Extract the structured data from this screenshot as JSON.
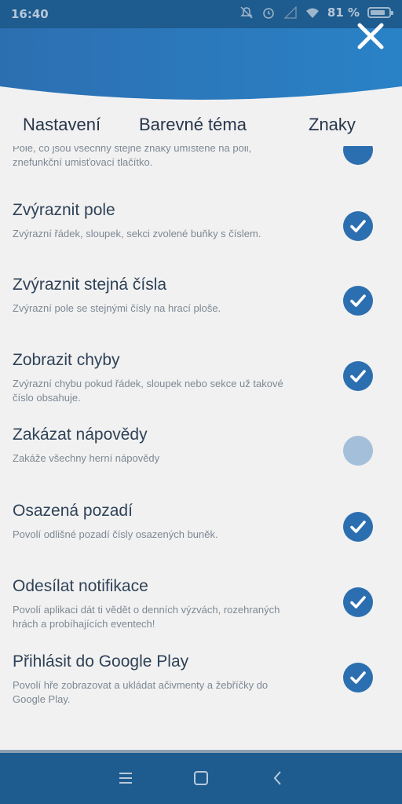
{
  "status": {
    "time": "16:40",
    "battery": "81 %",
    "battery_level": 0.81,
    "icons": [
      "mute-icon",
      "alarm-icon",
      "signal-icon",
      "wifi-icon",
      "battery-icon"
    ]
  },
  "header": {
    "close_icon": "close-icon"
  },
  "tabs": [
    "Nastavení",
    "Barevné téma",
    "Znaky"
  ],
  "partial_item": {
    "desc": "Pole, co jsou všechny stejné znaky umístěné na poli, znefunkční umisťovací tlačítko."
  },
  "items": [
    {
      "title": "Zvýraznit pole",
      "desc": "Zvýrazní řádek, sloupek, sekci zvolené buňky s číslem.",
      "checked": true
    },
    {
      "title": "Zvýraznit stejná čísla",
      "desc": "Zvýrazní pole se stejnými čísly na hrací ploše.",
      "checked": true
    },
    {
      "title": "Zobrazit chyby",
      "desc": "Zvýrazní chybu pokud řádek, sloupek nebo sekce už takové číslo obsahuje.",
      "checked": true
    },
    {
      "title": "Zakázat nápovědy",
      "desc": "Zakáže všechny herní nápovědy",
      "checked": false
    },
    {
      "title": "Osazená pozadí",
      "desc": "Povolí odlišné pozadí čísly osazených buněk.",
      "checked": true
    },
    {
      "title": "Odesílat notifikace",
      "desc": "Povolí aplikaci dát ti vědět o denních výzvách, rozehraných hrách a probíhajících eventech!",
      "checked": true
    },
    {
      "title": "Přihlásit do Google Play",
      "desc": "Povolí hře zobrazovat a ukládat ačivmenty a žebříčky do Google Play.",
      "checked": true
    }
  ],
  "nav": {
    "icons": [
      "menu-icon",
      "home-icon",
      "back-icon"
    ]
  },
  "colors": {
    "primary": "#2c6fb1",
    "dark": "#1e5b8e",
    "unchecked": "#a3bfda",
    "background": "#f1f1f1"
  }
}
